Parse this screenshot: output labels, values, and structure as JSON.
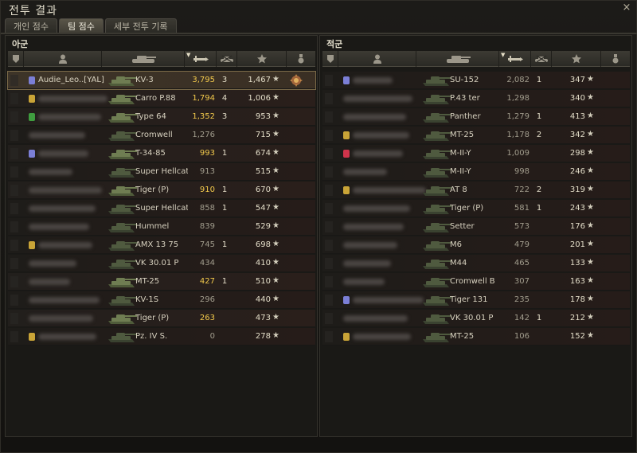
{
  "window": {
    "title": "전투 결과",
    "close_glyph": "×"
  },
  "tabs": [
    {
      "label": "개인 점수",
      "active": false
    },
    {
      "label": "팀 점수",
      "active": true
    },
    {
      "label": "세부 전투 기록",
      "active": false
    }
  ],
  "headers": {
    "sort_glyph": "▼",
    "icons": [
      "platoon-icon",
      "player-icon",
      "tank-icon",
      "damage-icon",
      "frags-icon",
      "xp-star-icon",
      "medal-icon"
    ]
  },
  "colors": {
    "damage_high": "#f2c94c",
    "damage_low": "#7d786c",
    "row_highlight": "#3d3428",
    "panel_bg": "#1a1916"
  },
  "allies": {
    "label": "아군",
    "rows": [
      {
        "name": "Audie_Leo..[YAL]",
        "badge": "#7b7fd6",
        "tank": "KV-3",
        "damage": "3,795",
        "kills": "3",
        "xp": "1,467",
        "star": "★",
        "medal": true,
        "highlight": true
      },
      {
        "name": "",
        "badge": "#c9a437",
        "tank": "Carro P.88",
        "damage": "1,794",
        "kills": "4",
        "xp": "1,006",
        "star": "★"
      },
      {
        "name": "",
        "badge": "#3f9d3f",
        "tank": "Type 64",
        "damage": "1,352",
        "kills": "3",
        "xp": "953",
        "star": "★"
      },
      {
        "name": "",
        "tank": "Cromwell",
        "damage": "1,276",
        "kills": "",
        "xp": "715",
        "star": "★",
        "dim": true
      },
      {
        "name": "",
        "badge": "#7b7fd6",
        "tank": "T-34-85",
        "damage": "993",
        "kills": "1",
        "xp": "674",
        "star": "★"
      },
      {
        "name": "",
        "tank": "Super Hellcat",
        "damage": "913",
        "kills": "",
        "xp": "515",
        "star": "★",
        "dim": true
      },
      {
        "name": "",
        "tank": "Tiger (P)",
        "damage": "910",
        "kills": "1",
        "xp": "670",
        "star": "★"
      },
      {
        "name": "",
        "tank": "Super Hellcat",
        "damage": "858",
        "kills": "1",
        "xp": "547",
        "star": "★",
        "dim": true
      },
      {
        "name": "",
        "tank": "Hummel",
        "damage": "839",
        "kills": "",
        "xp": "529",
        "star": "★",
        "dim": true
      },
      {
        "name": "",
        "badge": "#c9a437",
        "tank": "AMX 13 75",
        "damage": "745",
        "kills": "1",
        "xp": "698",
        "star": "★",
        "dim": true
      },
      {
        "name": "",
        "tank": "VK 30.01 P",
        "damage": "434",
        "kills": "",
        "xp": "410",
        "star": "★",
        "dim": true
      },
      {
        "name": "",
        "tank": "MT-25",
        "damage": "427",
        "kills": "1",
        "xp": "510",
        "star": "★"
      },
      {
        "name": "",
        "tank": "KV-1S",
        "damage": "296",
        "kills": "",
        "xp": "440",
        "star": "★",
        "dim": true
      },
      {
        "name": "",
        "tank": "Tiger (P)",
        "damage": "263",
        "kills": "",
        "xp": "473",
        "star": "★"
      },
      {
        "name": "",
        "badge": "#c9a437",
        "tank": "Pz. IV S.",
        "damage": "0",
        "kills": "",
        "xp": "278",
        "star": "★",
        "dim": true
      }
    ]
  },
  "enemies": {
    "label": "적군",
    "rows": [
      {
        "name": "",
        "badge": "#7b7fd6",
        "tank": "SU-152",
        "damage": "2,082",
        "kills": "1",
        "xp": "347",
        "star": "★",
        "dim": true
      },
      {
        "name": "",
        "tank": "P.43 ter",
        "damage": "1,298",
        "kills": "",
        "xp": "340",
        "star": "★",
        "dim": true
      },
      {
        "name": "",
        "tank": "Panther",
        "damage": "1,279",
        "kills": "1",
        "xp": "413",
        "star": "★",
        "dim": true
      },
      {
        "name": "",
        "badge": "#c9a437",
        "tank": "MT-25",
        "damage": "1,178",
        "kills": "2",
        "xp": "342",
        "star": "★",
        "dim": true
      },
      {
        "name": "",
        "badge": "#d0344b",
        "tank": "M-II-Y",
        "damage": "1,009",
        "kills": "",
        "xp": "298",
        "star": "★",
        "dim": true
      },
      {
        "name": "",
        "tank": "M-II-Y",
        "damage": "998",
        "kills": "",
        "xp": "246",
        "star": "★",
        "dim": true
      },
      {
        "name": "",
        "badge": "#c9a437",
        "tank": "AT 8",
        "damage": "722",
        "kills": "2",
        "xp": "319",
        "star": "★",
        "dim": true
      },
      {
        "name": "",
        "tank": "Tiger (P)",
        "damage": "581",
        "kills": "1",
        "xp": "243",
        "star": "★",
        "dim": true
      },
      {
        "name": "",
        "tank": "Setter",
        "damage": "573",
        "kills": "",
        "xp": "176",
        "star": "★",
        "dim": true
      },
      {
        "name": "",
        "tank": "M6",
        "damage": "479",
        "kills": "",
        "xp": "201",
        "star": "★",
        "dim": true
      },
      {
        "name": "",
        "tank": "M44",
        "damage": "465",
        "kills": "",
        "xp": "133",
        "star": "★",
        "dim": true
      },
      {
        "name": "",
        "tank": "Cromwell B",
        "damage": "307",
        "kills": "",
        "xp": "163",
        "star": "★",
        "dim": true
      },
      {
        "name": "",
        "badge": "#7b7fd6",
        "tank": "Tiger 131",
        "damage": "235",
        "kills": "",
        "xp": "178",
        "star": "★",
        "dim": true
      },
      {
        "name": "",
        "tank": "VK 30.01 P",
        "damage": "142",
        "kills": "1",
        "xp": "212",
        "star": "★",
        "dim": true
      },
      {
        "name": "",
        "badge": "#c9a437",
        "tank": "MT-25",
        "damage": "106",
        "kills": "",
        "xp": "152",
        "star": "★",
        "dim": true
      }
    ]
  }
}
